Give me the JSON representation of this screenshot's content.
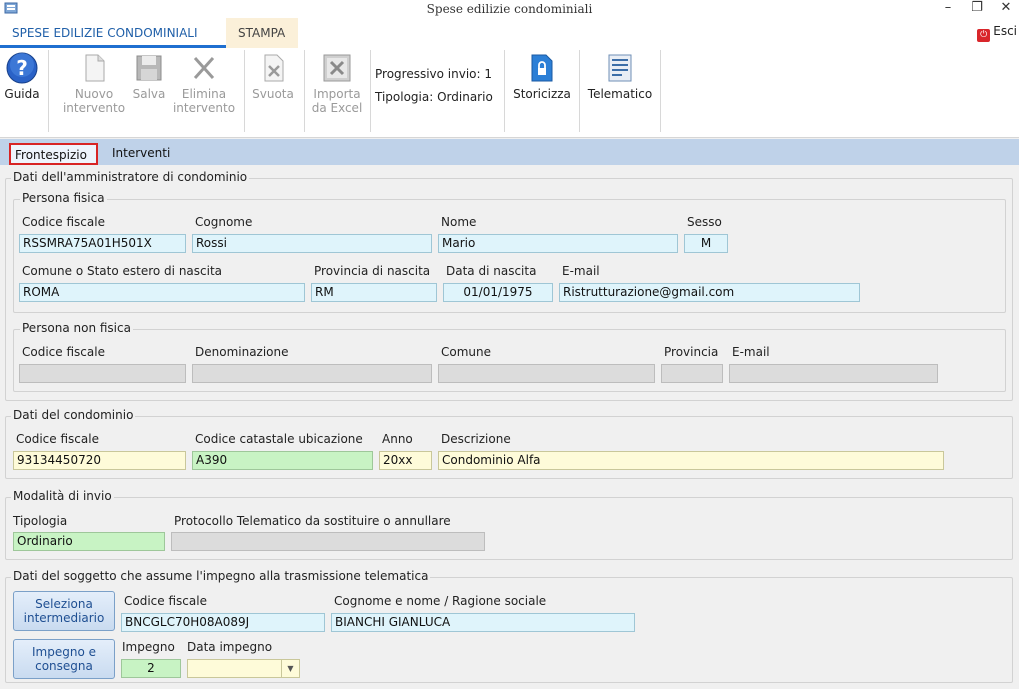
{
  "window": {
    "title": "Spese edilizie condominiali",
    "minimize": "–",
    "restore": "❐",
    "close": "✕"
  },
  "ribbon": {
    "tabs": [
      "SPESE EDILIZIE CONDOMINIALI",
      "STAMPA"
    ],
    "exit_label": "Esci"
  },
  "toolbar": {
    "guida": "Guida",
    "nuovo": [
      "Nuovo",
      "intervento"
    ],
    "salva": "Salva",
    "elimina": [
      "Elimina",
      "intervento"
    ],
    "svuota": "Svuota",
    "importa": [
      "Importa",
      "da Excel"
    ],
    "progressivo": "Progressivo invio: 1",
    "tipologia": "Tipologia: Ordinario",
    "storicizza": "Storicizza",
    "telematico": "Telematico"
  },
  "page_tabs": [
    "Frontespizio",
    "Interventi"
  ],
  "amministratore": {
    "title": "Dati dell'amministratore di condominio",
    "persona_fisica": {
      "title": "Persona fisica",
      "labels": {
        "codice_fiscale": "Codice fiscale",
        "cognome": "Cognome",
        "nome": "Nome",
        "sesso": "Sesso",
        "comune": "Comune o Stato estero di nascita",
        "provincia": "Provincia di nascita",
        "data": "Data di nascita",
        "email": "E-mail"
      },
      "values": {
        "codice_fiscale": "RSSMRA75A01H501X",
        "cognome": "Rossi",
        "nome": "Mario",
        "sesso": "M",
        "comune": "ROMA",
        "provincia": "RM",
        "data": "01/01/1975",
        "email": "Ristrutturazione@gmail.com"
      }
    },
    "persona_non_fisica": {
      "title": "Persona non fisica",
      "labels": {
        "codice_fiscale": "Codice fiscale",
        "denominazione": "Denominazione",
        "comune": "Comune",
        "provincia": "Provincia",
        "email": "E-mail"
      }
    }
  },
  "condominio": {
    "title": "Dati del condominio",
    "labels": {
      "codice_fiscale": "Codice fiscale",
      "catastale": "Codice catastale ubicazione",
      "anno": "Anno",
      "descrizione": "Descrizione"
    },
    "values": {
      "codice_fiscale": "93134450720",
      "catastale": "A390",
      "anno": "20xx",
      "descrizione": "Condominio Alfa"
    }
  },
  "modalita": {
    "title": "Modalità di invio",
    "labels": {
      "tipologia": "Tipologia",
      "protocollo": "Protocollo Telematico da sostituire o annullare"
    },
    "values": {
      "tipologia": "Ordinario"
    }
  },
  "soggetto": {
    "title": "Dati del soggetto che assume l'impegno alla trasmissione telematica",
    "btn_seleziona": [
      "Seleziona",
      "intermediario"
    ],
    "btn_impegno": [
      "Impegno e",
      "consegna"
    ],
    "labels": {
      "codice_fiscale": "Codice fiscale",
      "cognome_nome": "Cognome e nome / Ragione sociale",
      "impegno": "Impegno",
      "data_impegno": "Data impegno"
    },
    "values": {
      "codice_fiscale": "BNCGLC70H08A089J",
      "cognome_nome": "BIANCHI  GIANLUCA",
      "impegno": "2"
    }
  }
}
